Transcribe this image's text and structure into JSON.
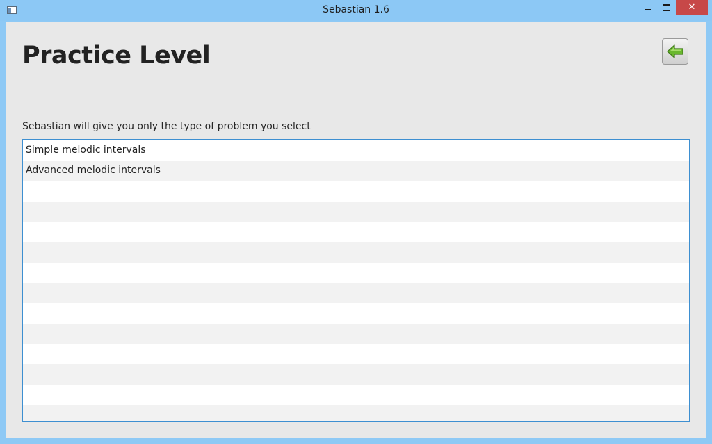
{
  "window": {
    "title": "Sebastian 1.6",
    "controls": {
      "minimize_icon": "minimize-icon",
      "maximize_icon": "maximize-icon",
      "close_label": "✕"
    }
  },
  "page": {
    "title": "Practice Level",
    "back_button_icon": "back-arrow-icon",
    "instruction": "Sebastian will give you only the type of problem you select"
  },
  "list": {
    "items": [
      "Simple melodic intervals",
      "Advanced melodic intervals",
      "",
      "",
      "",
      "",
      "",
      "",
      "",
      "",
      "",
      "",
      "",
      ""
    ]
  },
  "colors": {
    "titlebar": "#8cc8f5",
    "close_button": "#c74848",
    "content_background": "#e8e8e8",
    "list_border": "#3d8fd1",
    "back_arrow": "#6ab82e"
  }
}
